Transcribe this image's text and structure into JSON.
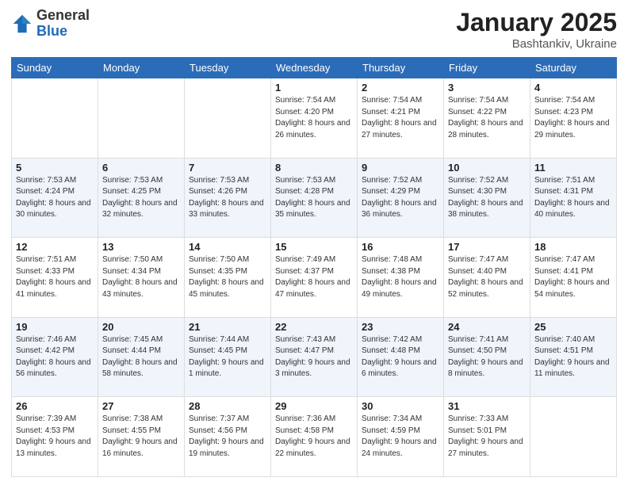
{
  "logo": {
    "general": "General",
    "blue": "Blue"
  },
  "title": {
    "month": "January 2025",
    "location": "Bashtankiv, Ukraine"
  },
  "weekdays": [
    "Sunday",
    "Monday",
    "Tuesday",
    "Wednesday",
    "Thursday",
    "Friday",
    "Saturday"
  ],
  "weeks": [
    [
      {
        "day": "",
        "info": ""
      },
      {
        "day": "",
        "info": ""
      },
      {
        "day": "",
        "info": ""
      },
      {
        "day": "1",
        "info": "Sunrise: 7:54 AM\nSunset: 4:20 PM\nDaylight: 8 hours\nand 26 minutes."
      },
      {
        "day": "2",
        "info": "Sunrise: 7:54 AM\nSunset: 4:21 PM\nDaylight: 8 hours\nand 27 minutes."
      },
      {
        "day": "3",
        "info": "Sunrise: 7:54 AM\nSunset: 4:22 PM\nDaylight: 8 hours\nand 28 minutes."
      },
      {
        "day": "4",
        "info": "Sunrise: 7:54 AM\nSunset: 4:23 PM\nDaylight: 8 hours\nand 29 minutes."
      }
    ],
    [
      {
        "day": "5",
        "info": "Sunrise: 7:53 AM\nSunset: 4:24 PM\nDaylight: 8 hours\nand 30 minutes."
      },
      {
        "day": "6",
        "info": "Sunrise: 7:53 AM\nSunset: 4:25 PM\nDaylight: 8 hours\nand 32 minutes."
      },
      {
        "day": "7",
        "info": "Sunrise: 7:53 AM\nSunset: 4:26 PM\nDaylight: 8 hours\nand 33 minutes."
      },
      {
        "day": "8",
        "info": "Sunrise: 7:53 AM\nSunset: 4:28 PM\nDaylight: 8 hours\nand 35 minutes."
      },
      {
        "day": "9",
        "info": "Sunrise: 7:52 AM\nSunset: 4:29 PM\nDaylight: 8 hours\nand 36 minutes."
      },
      {
        "day": "10",
        "info": "Sunrise: 7:52 AM\nSunset: 4:30 PM\nDaylight: 8 hours\nand 38 minutes."
      },
      {
        "day": "11",
        "info": "Sunrise: 7:51 AM\nSunset: 4:31 PM\nDaylight: 8 hours\nand 40 minutes."
      }
    ],
    [
      {
        "day": "12",
        "info": "Sunrise: 7:51 AM\nSunset: 4:33 PM\nDaylight: 8 hours\nand 41 minutes."
      },
      {
        "day": "13",
        "info": "Sunrise: 7:50 AM\nSunset: 4:34 PM\nDaylight: 8 hours\nand 43 minutes."
      },
      {
        "day": "14",
        "info": "Sunrise: 7:50 AM\nSunset: 4:35 PM\nDaylight: 8 hours\nand 45 minutes."
      },
      {
        "day": "15",
        "info": "Sunrise: 7:49 AM\nSunset: 4:37 PM\nDaylight: 8 hours\nand 47 minutes."
      },
      {
        "day": "16",
        "info": "Sunrise: 7:48 AM\nSunset: 4:38 PM\nDaylight: 8 hours\nand 49 minutes."
      },
      {
        "day": "17",
        "info": "Sunrise: 7:47 AM\nSunset: 4:40 PM\nDaylight: 8 hours\nand 52 minutes."
      },
      {
        "day": "18",
        "info": "Sunrise: 7:47 AM\nSunset: 4:41 PM\nDaylight: 8 hours\nand 54 minutes."
      }
    ],
    [
      {
        "day": "19",
        "info": "Sunrise: 7:46 AM\nSunset: 4:42 PM\nDaylight: 8 hours\nand 56 minutes."
      },
      {
        "day": "20",
        "info": "Sunrise: 7:45 AM\nSunset: 4:44 PM\nDaylight: 8 hours\nand 58 minutes."
      },
      {
        "day": "21",
        "info": "Sunrise: 7:44 AM\nSunset: 4:45 PM\nDaylight: 9 hours\nand 1 minute."
      },
      {
        "day": "22",
        "info": "Sunrise: 7:43 AM\nSunset: 4:47 PM\nDaylight: 9 hours\nand 3 minutes."
      },
      {
        "day": "23",
        "info": "Sunrise: 7:42 AM\nSunset: 4:48 PM\nDaylight: 9 hours\nand 6 minutes."
      },
      {
        "day": "24",
        "info": "Sunrise: 7:41 AM\nSunset: 4:50 PM\nDaylight: 9 hours\nand 8 minutes."
      },
      {
        "day": "25",
        "info": "Sunrise: 7:40 AM\nSunset: 4:51 PM\nDaylight: 9 hours\nand 11 minutes."
      }
    ],
    [
      {
        "day": "26",
        "info": "Sunrise: 7:39 AM\nSunset: 4:53 PM\nDaylight: 9 hours\nand 13 minutes."
      },
      {
        "day": "27",
        "info": "Sunrise: 7:38 AM\nSunset: 4:55 PM\nDaylight: 9 hours\nand 16 minutes."
      },
      {
        "day": "28",
        "info": "Sunrise: 7:37 AM\nSunset: 4:56 PM\nDaylight: 9 hours\nand 19 minutes."
      },
      {
        "day": "29",
        "info": "Sunrise: 7:36 AM\nSunset: 4:58 PM\nDaylight: 9 hours\nand 22 minutes."
      },
      {
        "day": "30",
        "info": "Sunrise: 7:34 AM\nSunset: 4:59 PM\nDaylight: 9 hours\nand 24 minutes."
      },
      {
        "day": "31",
        "info": "Sunrise: 7:33 AM\nSunset: 5:01 PM\nDaylight: 9 hours\nand 27 minutes."
      },
      {
        "day": "",
        "info": ""
      }
    ]
  ]
}
